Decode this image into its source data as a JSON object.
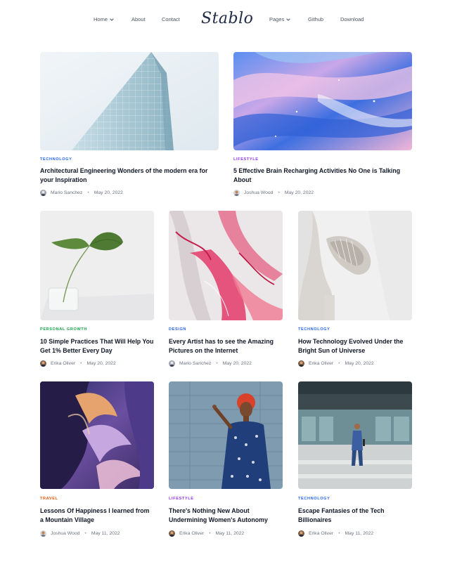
{
  "nav": {
    "home": "Home",
    "about": "About",
    "contact": "Contact",
    "logo": "Stablo",
    "pages": "Pages",
    "github": "Github",
    "download": "Download"
  },
  "posts": [
    {
      "category": "Technology",
      "category_color": "#2563eb",
      "title": "Architectural Engineering Wonders of the modern era for your Inspiration",
      "author": "Mario Sanchez",
      "date": "May 20, 2022"
    },
    {
      "category": "Lifestyle",
      "category_color": "#9333ea",
      "title": "5 Effective Brain Recharging Activities No One is Talking About",
      "author": "Joshua Wood",
      "date": "May 20, 2022"
    },
    {
      "category": "Personal Growth",
      "category_color": "#16a34a",
      "title": "10 Simple Practices That Will Help You Get 1% Better Every Day",
      "author": "Erika Oliver",
      "date": "May 20, 2022"
    },
    {
      "category": "Design",
      "category_color": "#2563eb",
      "title": "Every Artist has to see the Amazing Pictures on the Internet",
      "author": "Mario Sanchez",
      "date": "May 20, 2022"
    },
    {
      "category": "Technology",
      "category_color": "#2563eb",
      "title": "How Technology Evolved Under the Bright Sun of Universe",
      "author": "Erika Oliver",
      "date": "May 20, 2022"
    },
    {
      "category": "Travel",
      "category_color": "#ea580c",
      "title": "Lessons Of Happiness I learned from a Mountain Village",
      "author": "Joshua Wood",
      "date": "May 11, 2022"
    },
    {
      "category": "Lifestyle",
      "category_color": "#9333ea",
      "title": "There's Nothing New About Undermining Women's Autonomy",
      "author": "Erika Oliver",
      "date": "May 11, 2022"
    },
    {
      "category": "Technology",
      "category_color": "#2563eb",
      "title": "Escape Fantasies of the Tech Billionaires",
      "author": "Erika Oliver",
      "date": "May 11, 2022"
    }
  ],
  "meta_separator": "•"
}
